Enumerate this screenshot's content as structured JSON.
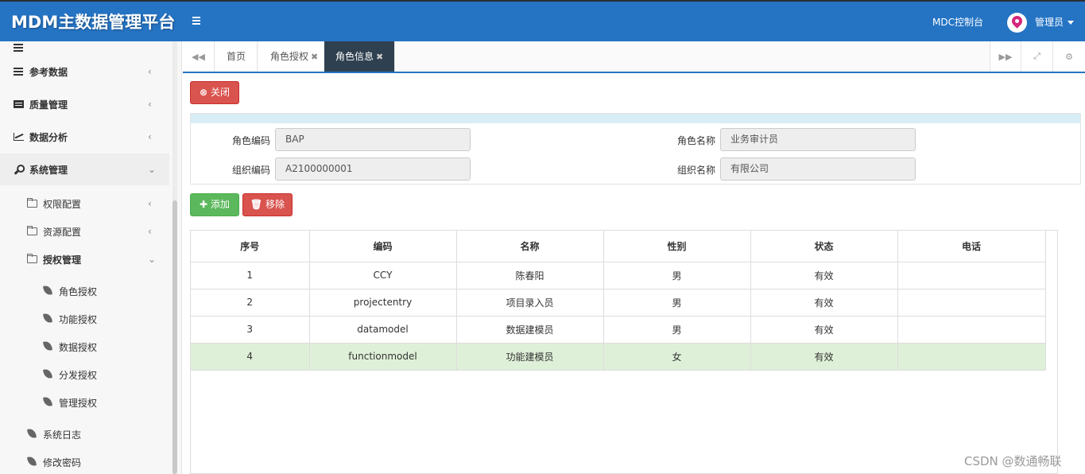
{
  "header": {
    "brand": "MDM主数据管理平台",
    "console_link": "MDC控制台",
    "user_name": "管理员"
  },
  "sidebar": {
    "items": [
      {
        "label": "参考数据",
        "icon": "list-icon"
      },
      {
        "label": "质量管理",
        "icon": "card-icon"
      },
      {
        "label": "数据分析",
        "icon": "chart-icon"
      },
      {
        "label": "系统管理",
        "icon": "wrench-icon"
      },
      {
        "label": "权限配置",
        "icon": "folder-icon"
      },
      {
        "label": "资源配置",
        "icon": "folder-icon"
      },
      {
        "label": "授权管理",
        "icon": "folder-icon"
      },
      {
        "label": "角色授权",
        "icon": "leaf-icon"
      },
      {
        "label": "功能授权",
        "icon": "leaf-icon"
      },
      {
        "label": "数据授权",
        "icon": "leaf-icon"
      },
      {
        "label": "分发授权",
        "icon": "leaf-icon"
      },
      {
        "label": "管理授权",
        "icon": "leaf-icon"
      },
      {
        "label": "系统日志",
        "icon": "leaf-icon"
      },
      {
        "label": "修改密码",
        "icon": "leaf-icon"
      }
    ]
  },
  "tabs": [
    {
      "label": "首页",
      "closable": false
    },
    {
      "label": "角色授权",
      "closable": true
    },
    {
      "label": "角色信息",
      "closable": true,
      "active": true
    }
  ],
  "toolbar": {
    "close_label": "关闭",
    "add_label": "添加",
    "remove_label": "移除"
  },
  "form": {
    "role_code_label": "角色编码",
    "role_code_value": "BAP",
    "role_name_label": "角色名称",
    "role_name_value": "业务审计员",
    "org_code_label": "组织编码",
    "org_code_value": "A2100000001",
    "org_name_label": "组织名称",
    "org_name_value": "有限公司"
  },
  "table": {
    "columns": [
      "序号",
      "编码",
      "名称",
      "性别",
      "状态",
      "电话"
    ],
    "rows": [
      [
        "1",
        "CCY",
        "陈春阳",
        "男",
        "有效",
        ""
      ],
      [
        "2",
        "projectentry",
        "项目录入员",
        "男",
        "有效",
        ""
      ],
      [
        "3",
        "datamodel",
        "数据建模员",
        "男",
        "有效",
        ""
      ],
      [
        "4",
        "functionmodel",
        "功能建模员",
        "女",
        "有效",
        ""
      ]
    ],
    "selected_row": 4
  },
  "watermark": "CSDN @数通畅联",
  "colors": {
    "header_bg": "#2574c4",
    "active_tab_bg": "#2f4050",
    "danger": "#d9534f",
    "success": "#5cb85c",
    "selected_row": "#dff0d8"
  }
}
